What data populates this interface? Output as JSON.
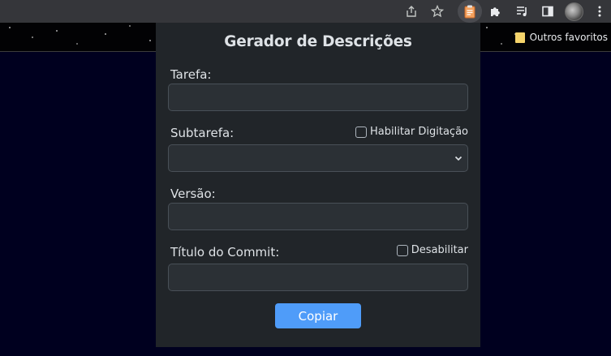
{
  "browser": {
    "bookmark_folder_label": "Outros favoritos",
    "icons": [
      "share-icon",
      "star-icon",
      "clipboard-extension-icon",
      "puzzle-icon",
      "media-queue-icon",
      "side-panel-icon",
      "profile-avatar",
      "kebab-menu-icon"
    ]
  },
  "popup": {
    "title": "Gerador de Descrições",
    "fields": {
      "tarefa": {
        "label": "Tarefa:",
        "value": ""
      },
      "subtarefa": {
        "label": "Subtarefa:",
        "value": "",
        "toggle_label": "Habilitar Digitação",
        "toggle_checked": false
      },
      "versao": {
        "label": "Versão:",
        "value": ""
      },
      "titulo_commit": {
        "label": "Título do Commit:",
        "value": "",
        "toggle_label": "Desabilitar",
        "toggle_checked": false
      }
    },
    "copy_button_label": "Copiar",
    "colors": {
      "background": "#212529",
      "input_bg": "#2b3035",
      "input_border": "#495057",
      "primary": "#4f9cf9",
      "page_bg": "#00001f"
    }
  }
}
